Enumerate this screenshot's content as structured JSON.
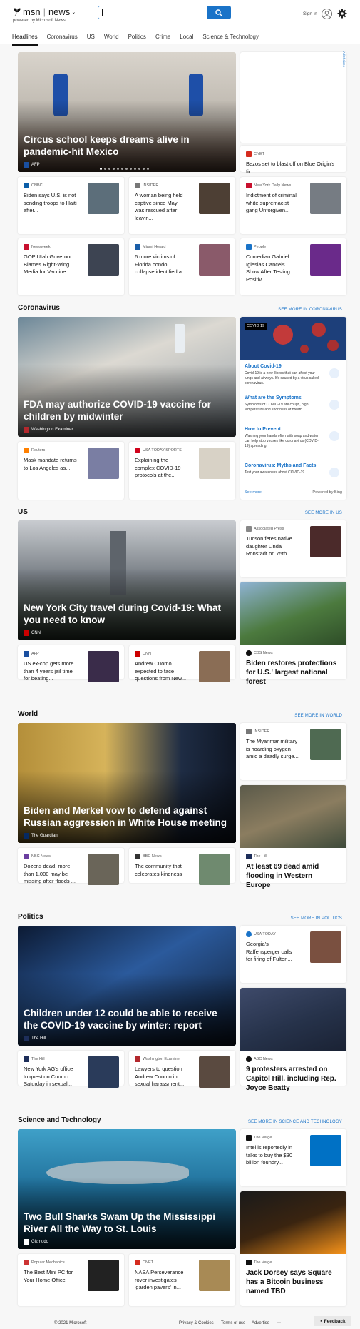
{
  "header": {
    "logo_msn": "msn",
    "logo_news": "news",
    "powered_by": "powered by Microsoft News",
    "search_placeholder": "",
    "sign_in": "Sign in"
  },
  "nav": [
    "Headlines",
    "Coronavirus",
    "US",
    "World",
    "Politics",
    "Crime",
    "Local",
    "Science & Technology"
  ],
  "headlines": {
    "hero": {
      "title": "Circus school keeps dreams alive in pandemic-hit Mexico",
      "source": "AFP"
    },
    "side_card": {
      "source": "CNET",
      "title": "Bezos set to blast off on Blue Origin's fir..."
    },
    "cards": [
      {
        "source": "CNBC",
        "title": "Biden says U.S. is not sending troops to Haiti after..."
      },
      {
        "source": "INSIDER",
        "title": "A woman being held captive since May was rescued after leavin..."
      },
      {
        "source": "New York Daily News",
        "title": "Indictment of criminal white supremacist gang Unforgiven..."
      },
      {
        "source": "Newsweek",
        "title": "GOP Utah Governor Blames Right-Wing Media for Vaccine..."
      },
      {
        "source": "Miami Herald",
        "title": "6 more victims of Florida condo collapse identified a..."
      },
      {
        "source": "People",
        "title": "Comedian Gabriel Iglesias Cancels Show After Testing Positiv..."
      }
    ]
  },
  "coronavirus": {
    "title": "Coronavirus",
    "see_more": "SEE MORE IN CORONAVIRUS",
    "hero": {
      "title": "FDA may authorize COVID-19 vaccine for children by midwinter",
      "source": "Washington Examiner"
    },
    "cards": [
      {
        "source": "Reuters",
        "title": "Mask mandate returns to Los Angeles as..."
      },
      {
        "source": "USA TODAY SPORTS",
        "title": "Explaining the complex COVID-19 protocols at the..."
      }
    ],
    "panel": {
      "badge": "COVID 19",
      "items": [
        {
          "title": "About Covid-19",
          "text": "Covid-19 is a new illness that can affect your lungs and airways. It's caused by a virus called coronavirus."
        },
        {
          "title": "What are the Symptoms",
          "text": "Symptoms of COVID-19 are cough, high temperature and shortness of breath."
        },
        {
          "title": "How to Prevent",
          "text": "Washing your hands often with soap and water can help stop viruses like coronavirus (COVID-19) spreading."
        },
        {
          "title": "Coronavirus: Myths and Facts",
          "text": "Test your awareness about COVID-19."
        }
      ],
      "see_more": "See more",
      "powered": "Powered by Bing"
    }
  },
  "us": {
    "title": "US",
    "see_more": "SEE MORE IN US",
    "hero": {
      "title": "New York City travel during Covid-19: What you need to know",
      "source": "CNN"
    },
    "side_card": {
      "source": "Associated Press",
      "title": "Tucson fetes native daughter Linda Ronstadt on 75th..."
    },
    "big_card": {
      "source": "CBS News",
      "title": "Biden restores protections for U.S.' largest national forest"
    },
    "cards": [
      {
        "source": "AFP",
        "title": "US ex-cop gets more than 4 years jail time for beating..."
      },
      {
        "source": "CNN",
        "title": "Andrew Cuomo expected to face questions from New..."
      }
    ]
  },
  "world": {
    "title": "World",
    "see_more": "SEE MORE IN WORLD",
    "hero": {
      "title": "Biden and Merkel vow to defend against Russian aggression in White House meeting",
      "source": "The Guardian"
    },
    "side_card": {
      "source": "INSIDER",
      "title": "The Myanmar military is hoarding oxygen amid a deadly surge..."
    },
    "big_card": {
      "source": "The Hill",
      "title": "At least 69 dead amid flooding in Western Europe"
    },
    "cards": [
      {
        "source": "NBC News",
        "title": "Dozens dead, more than 1,000 may be missing after floods ..."
      },
      {
        "source": "BBC News",
        "title": "The community that celebrates kindness"
      }
    ]
  },
  "politics": {
    "title": "Politics",
    "see_more": "SEE MORE IN POLITICS",
    "hero": {
      "title": "Children under 12 could be able to receive the COVID-19 vaccine by winter: report",
      "source": "The Hill"
    },
    "side_card": {
      "source": "USA TODAY",
      "title": "Georgia's Raffensperger calls for firing of Fulton..."
    },
    "big_card": {
      "source": "ABC News",
      "title": "9 protesters arrested on Capitol Hill, including Rep. Joyce Beatty"
    },
    "cards": [
      {
        "source": "The Hill",
        "title": "New York AG's office to question Cuomo Saturday in sexual..."
      },
      {
        "source": "Washington Examiner",
        "title": "Lawyers to question Andrew Cuomo in sexual harassment..."
      }
    ]
  },
  "scitech": {
    "title": "Science and Technology",
    "see_more": "SEE MORE IN SCIENCE AND TECHNOLOGY",
    "hero": {
      "title": "Two Bull Sharks Swam Up the Mississippi River All the Way to St. Louis",
      "source": "Gizmodo"
    },
    "side_card": {
      "source": "The Verge",
      "title": "Intel is reportedly in talks to buy the $30 billion foundry..."
    },
    "big_card": {
      "source": "The Verge",
      "title": "Jack Dorsey says Square has a Bitcoin business named TBD"
    },
    "cards": [
      {
        "source": "Popular Mechanics",
        "title": "The Best Mini PC for Your Home Office"
      },
      {
        "source": "CNET",
        "title": "NASA Perseverance rover investigates 'garden pavers' in..."
      }
    ]
  },
  "footer": {
    "copyright": "© 2021 Microsoft",
    "privacy": "Privacy & Cookies",
    "terms": "Terms of use",
    "advertise": "Advertise",
    "more": "···",
    "feedback": "Feedback"
  },
  "ad_label": "AdChoices",
  "colors": {
    "accent": "#1a73c8",
    "covid_panel": "#1d3f7a"
  }
}
